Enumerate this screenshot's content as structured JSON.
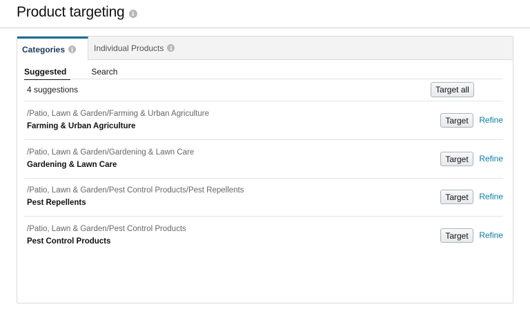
{
  "page": {
    "title": "Product targeting"
  },
  "tabs": [
    {
      "label": "Categories",
      "active": true
    },
    {
      "label": "Individual Products",
      "active": false
    }
  ],
  "subtabs": [
    {
      "label": "Suggested",
      "active": true
    },
    {
      "label": "Search",
      "active": false
    }
  ],
  "suggestions_count": "4 suggestions",
  "target_all_label": "Target all",
  "suggestions": [
    {
      "path": "/Patio, Lawn & Garden/Farming & Urban Agriculture",
      "name": "Farming & Urban Agriculture",
      "target_label": "Target",
      "refine_label": "Refine"
    },
    {
      "path": "/Patio, Lawn & Garden/Gardening & Lawn Care",
      "name": "Gardening & Lawn Care",
      "target_label": "Target",
      "refine_label": "Refine"
    },
    {
      "path": "/Patio, Lawn & Garden/Pest Control Products/Pest Repellents",
      "name": "Pest Repellents",
      "target_label": "Target",
      "refine_label": "Refine"
    },
    {
      "path": "/Patio, Lawn & Garden/Pest Control Products",
      "name": "Pest Control Products",
      "target_label": "Target",
      "refine_label": "Refine"
    }
  ],
  "colors": {
    "accent": "#1d6f93",
    "link": "#0a7aa5",
    "tab_bar": "#f3f3f3"
  },
  "icons": {
    "info": "info-icon"
  }
}
